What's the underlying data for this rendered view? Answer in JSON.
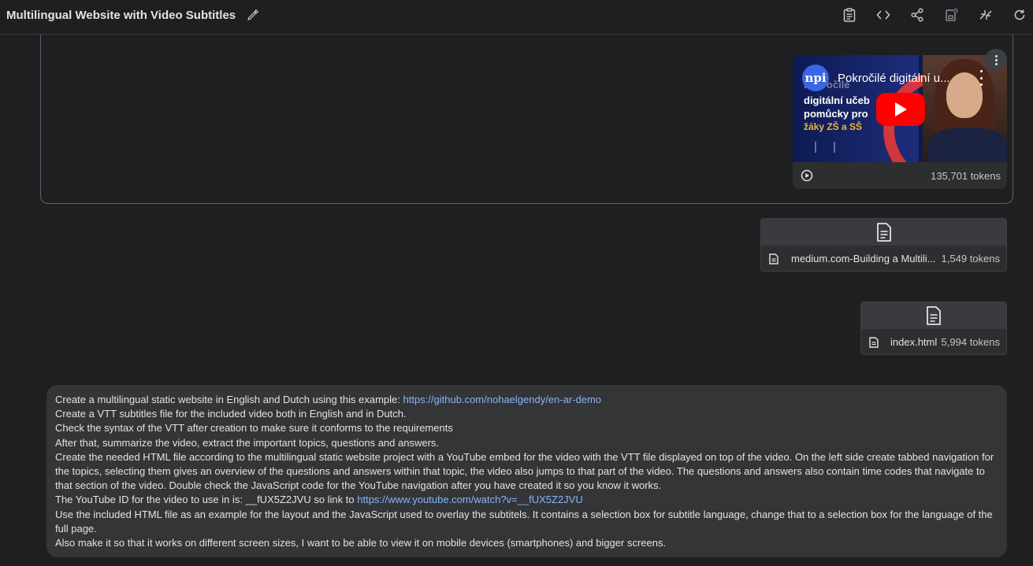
{
  "header": {
    "title": "Multilingual Website with Video Subtitles",
    "toolbar_icons": [
      "clipboard-icon",
      "code-icon",
      "share-icon",
      "save-icon",
      "compare-icon",
      "refresh-icon"
    ]
  },
  "video_card": {
    "channel_initials": "npi",
    "title": "Pokročilé digitální u...",
    "thumbnail_lines": [
      "Pokročilé",
      "digitální učeb",
      "pomůcky pro",
      "žáky ZŠ a SŠ"
    ],
    "tokens": "135,701 tokens"
  },
  "files": [
    {
      "name": "medium.com-Building a Multili...",
      "tokens": "1,549 tokens"
    },
    {
      "name": "index.html",
      "tokens": "5,994 tokens"
    }
  ],
  "prompt": {
    "line1_text": "Create a multilingual static website in English and Dutch using this example: ",
    "line1_link": "https://github.com/nohaelgendy/en-ar-demo",
    "line2": "Create a VTT subtitles file for the included video both in English and in Dutch.",
    "line3": "Check the syntax of the VTT after creation to make sure it conforms to the requirements",
    "line4": "After that, summarize the video, extract the important topics, questions and answers.",
    "line5": "Create the needed HTML file according to the multilingual static website project with a YouTube embed for the video with the VTT file displayed on top of the video. On the left side create tabbed navigation for the topics, selecting them gives an overview of the questions and answers within that topic, the video also jumps to that part of the video. The questions and answers also contain time codes that navigate to that section of the video. Double check the JavaScript code for the YouTube navigation after you have created it so you know it works.",
    "line6_text": "The YouTube ID for the video to use in is: __fUX5Z2JVU so link to ",
    "line6_link": "https://www.youtube.com/watch?v=__fUX5Z2JVU",
    "line7": "Use the included HTML file as an example for the layout and the JavaScript used to overlay the subtitels. It contains a selection box for subtitle language, change that to a selection box for the language of the full page.",
    "line8": "Also make it so that it works on different screen sizes, I want to be able to view it on mobile devices (smartphones) and bigger screens."
  },
  "colors": {
    "background": "#1e1f20",
    "card": "#2d2e30",
    "prompt_bg": "#333537",
    "link": "#8ab4f8",
    "play_red": "#ff0000"
  }
}
